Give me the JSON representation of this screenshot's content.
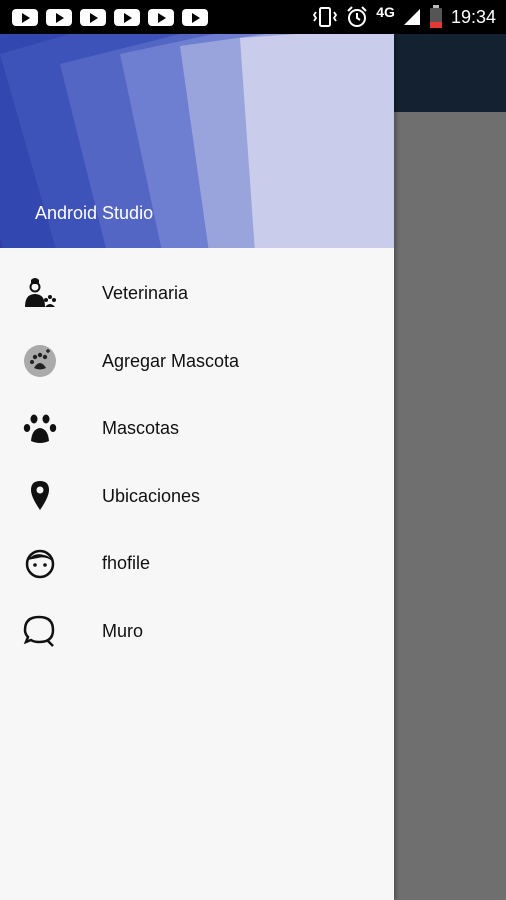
{
  "status_bar": {
    "notifications": [
      "youtube-icon",
      "youtube-icon",
      "youtube-icon",
      "youtube-icon",
      "youtube-icon",
      "youtube-icon"
    ],
    "network": "4G",
    "time": "19:34"
  },
  "drawer": {
    "header_title": "Android Studio",
    "items": [
      {
        "label": "Veterinaria",
        "icon": "veterinarian-icon"
      },
      {
        "label": "Agregar Mascota",
        "icon": "add-pet-icon"
      },
      {
        "label": "Mascotas",
        "icon": "paw-icon"
      },
      {
        "label": "Ubicaciones",
        "icon": "location-pin-icon"
      },
      {
        "label": "fhofile",
        "icon": "face-icon"
      },
      {
        "label": "Muro",
        "icon": "chat-bubble-icon"
      }
    ]
  },
  "colors": {
    "header_dark": "#2c3ea6",
    "header_light": "#c9cdeb",
    "toolbar": "#132131",
    "scrim": "#6f6f6f"
  }
}
